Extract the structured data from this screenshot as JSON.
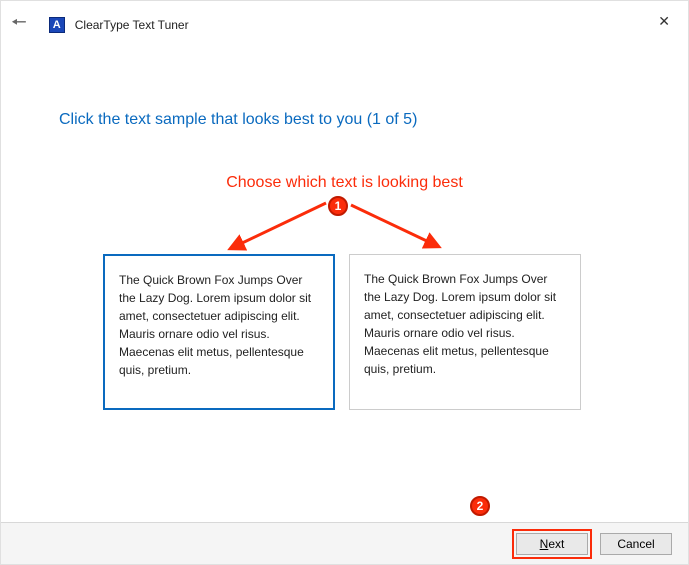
{
  "window": {
    "title": "ClearType Text Tuner"
  },
  "instruction": "Click the text sample that looks best to you (1 of 5)",
  "annotation": {
    "text": "Choose which text is looking best",
    "marker1": "1",
    "marker2": "2"
  },
  "samples": {
    "left": "The Quick Brown Fox Jumps Over the Lazy Dog. Lorem ipsum dolor sit amet, consectetuer adipiscing elit. Mauris ornare odio vel risus. Maecenas elit metus, pellentesque quis, pretium.",
    "right": "The Quick Brown Fox Jumps Over the Lazy Dog. Lorem ipsum dolor sit amet, consectetuer adipiscing elit. Mauris ornare odio vel risus. Maecenas elit metus, pellentesque quis, pretium."
  },
  "footer": {
    "next_prefix": "N",
    "next_rest": "ext",
    "cancel": "Cancel"
  }
}
